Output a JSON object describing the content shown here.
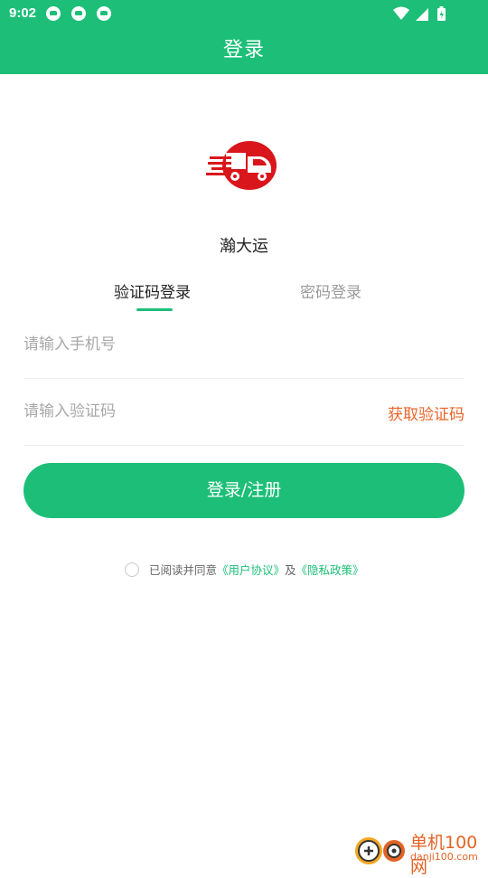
{
  "status_bar": {
    "time": "9:02",
    "notification_icons": [
      "driving-app-icon",
      "driving-app-icon",
      "driving-app-icon"
    ],
    "system_icons": [
      "wifi-icon",
      "cell-signal-icon",
      "battery-icon"
    ]
  },
  "app_bar": {
    "title": "登录"
  },
  "logo": {
    "icon": "delivery-truck-logo"
  },
  "app_name": "瀚大运",
  "tabs": [
    {
      "label": "验证码登录",
      "active": true
    },
    {
      "label": "密码登录",
      "active": false
    }
  ],
  "form": {
    "phone_placeholder": "请输入手机号",
    "phone_value": "",
    "code_placeholder": "请输入验证码",
    "code_value": "",
    "get_code_label": "获取验证码",
    "submit_label": "登录/注册"
  },
  "agreement": {
    "checked": false,
    "prefix": "已阅读并同意",
    "user_agreement": "《用户协议》",
    "conjunction": "及",
    "privacy_policy": "《隐私政策》"
  },
  "watermark": {
    "site": "单机100网",
    "url": "danji100.com"
  },
  "colors": {
    "primary": "#1dbf78",
    "accent": "#e8662b",
    "logo_red": "#d9161c"
  }
}
